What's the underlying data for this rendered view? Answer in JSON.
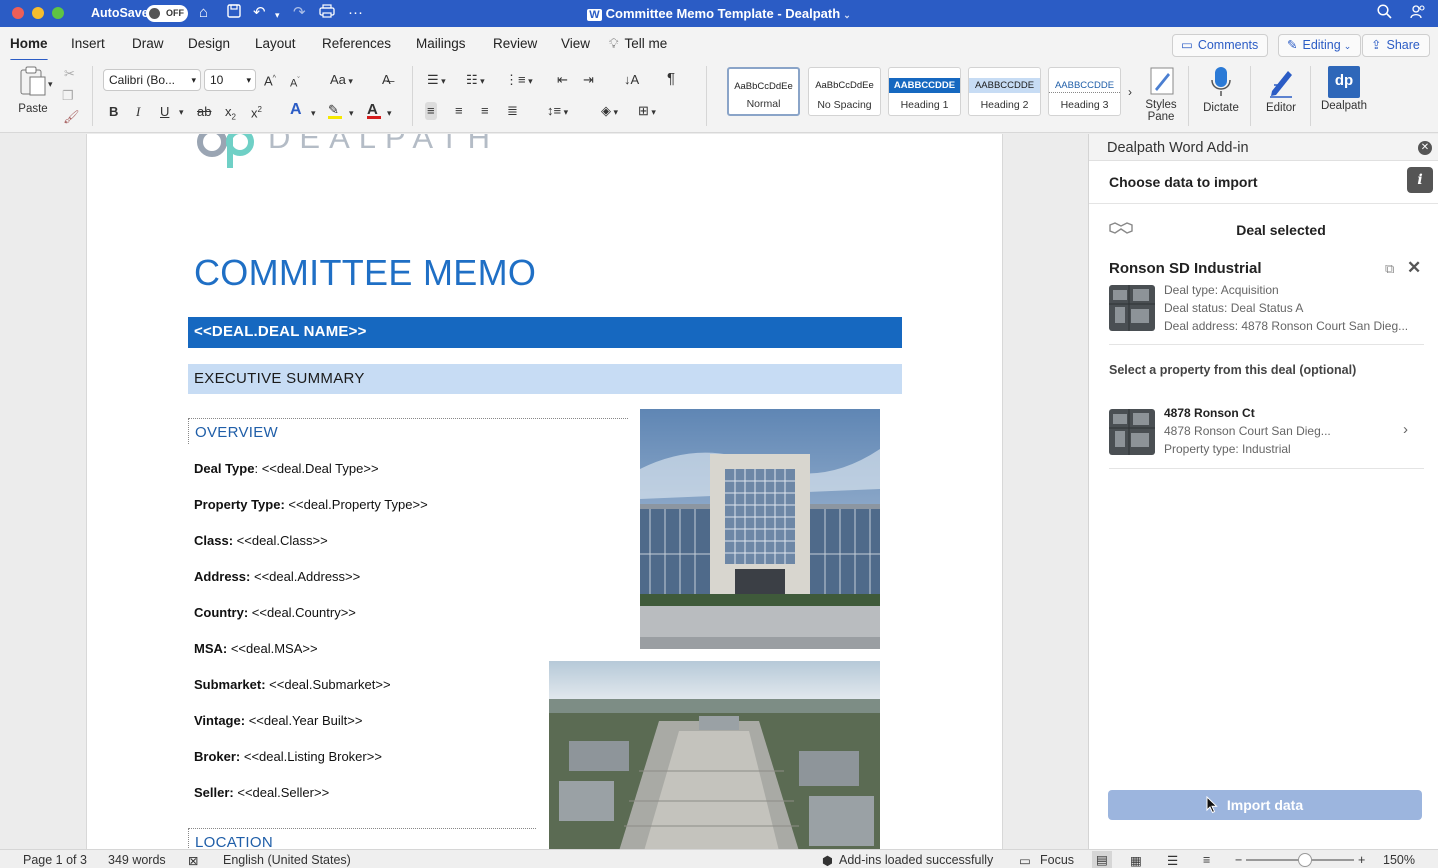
{
  "titlebar": {
    "autosave_label": "AutoSave",
    "autosave_state": "OFF",
    "doc_title": "Committee Memo Template - Dealpath",
    "icons": [
      "home-icon",
      "save-icon",
      "undo-icon",
      "redo-icon",
      "print-icon",
      "more-icon",
      "search-icon",
      "share-people-icon"
    ]
  },
  "tabs": [
    "Home",
    "Insert",
    "Draw",
    "Design",
    "Layout",
    "References",
    "Mailings",
    "Review",
    "View",
    "Tell me"
  ],
  "active_tab": "Home",
  "top_buttons": {
    "comments": "Comments",
    "editing": "Editing",
    "share": "Share"
  },
  "ribbon": {
    "paste_label": "Paste",
    "font_name": "Calibri (Bo...",
    "font_size": "10",
    "styles": [
      {
        "preview": "AaBbCcDdEe",
        "name": "Normal"
      },
      {
        "preview": "AaBbCcDdEe",
        "name": "No Spacing"
      },
      {
        "preview": "AABBCCDDE",
        "name": "Heading 1"
      },
      {
        "preview": "AABBCCDDE",
        "name": "Heading 2"
      },
      {
        "preview": "AABBCCDDE",
        "name": "Heading 3"
      }
    ],
    "styles_pane_line1": "Styles",
    "styles_pane_line2": "Pane",
    "dictate": "Dictate",
    "editor": "Editor",
    "dealpath": "Dealpath",
    "accent_color": "#2b5cc5"
  },
  "document": {
    "logo_text": "DEALPATH",
    "title": "COMMITTEE MEMO",
    "deal_name_placeholder": "<<DEAL.DEAL NAME>>",
    "section_exec": "EXECUTIVE SUMMARY",
    "section_overview": "OVERVIEW",
    "section_location": "LOCATION",
    "fields": [
      {
        "label": "Deal Type",
        "sep": ": ",
        "value": "<<deal.Deal Type>>"
      },
      {
        "label": "Property Type:",
        "sep": " ",
        "value": "<<deal.Property Type>>"
      },
      {
        "label": "Class:",
        "sep": " ",
        "value": "<<deal.Class>>"
      },
      {
        "label": "Address:",
        "sep": " ",
        "value": "<<deal.Address>>"
      },
      {
        "label": "Country:",
        "sep": " ",
        "value": "<<deal.Country>>"
      },
      {
        "label": "MSA:",
        "sep": " ",
        "value": "<<deal.MSA>>"
      },
      {
        "label": "Submarket:",
        "sep": " ",
        "value": "<<deal.Submarket>>"
      },
      {
        "label": "Vintage:",
        "sep": " ",
        "value": "<<deal.Year Built>>"
      },
      {
        "label": "Broker:",
        "sep": " ",
        "value": "<<deal.Listing Broker>>"
      },
      {
        "label": "Seller:",
        "sep": " ",
        "value": "<<deal.Seller>>"
      }
    ],
    "heading_color": "#1f6fc5",
    "bar_color": "#1668c0"
  },
  "pane": {
    "title": "Dealpath Word Add-in",
    "choose_label": "Choose data to import",
    "deal_selected": "Deal selected",
    "deal_name": "Ronson SD Industrial",
    "deal_type": "Deal type: Acquisition",
    "deal_status": "Deal status: Deal Status A",
    "deal_address": "Deal address: 4878 Ronson Court San Dieg...",
    "select_property": "Select a property from this deal (optional)",
    "property": {
      "name": "4878 Ronson Ct",
      "address": "4878 Ronson Court San Dieg...",
      "type": "Property type: Industrial"
    },
    "import_button": "Import data"
  },
  "statusbar": {
    "page": "Page 1 of 3",
    "words": "349 words",
    "language": "English (United States)",
    "addins": "Add-ins loaded successfully",
    "focus": "Focus",
    "zoom": "150%"
  }
}
